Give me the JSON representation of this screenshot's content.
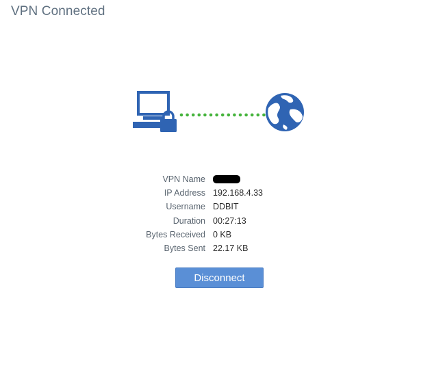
{
  "header": {
    "title": "VPN Connected"
  },
  "graphic": {
    "left_icon": "computer-lock-icon",
    "right_icon": "globe-icon",
    "connector": "dotted-line",
    "icon_color": "#2f64b3",
    "connector_color": "#45b33c"
  },
  "details": {
    "vpn_name_label": "VPN Name",
    "vpn_name_value": "",
    "vpn_name_redacted": true,
    "ip_address_label": "IP Address",
    "ip_address_value": "192.168.4.33",
    "username_label": "Username",
    "username_value": "DDBIT",
    "duration_label": "Duration",
    "duration_value": "00:27:13",
    "bytes_received_label": "Bytes Received",
    "bytes_received_value": "0 KB",
    "bytes_sent_label": "Bytes Sent",
    "bytes_sent_value": "22.17 KB"
  },
  "actions": {
    "disconnect_label": "Disconnect",
    "disconnect_color": "#5a8fd6"
  }
}
